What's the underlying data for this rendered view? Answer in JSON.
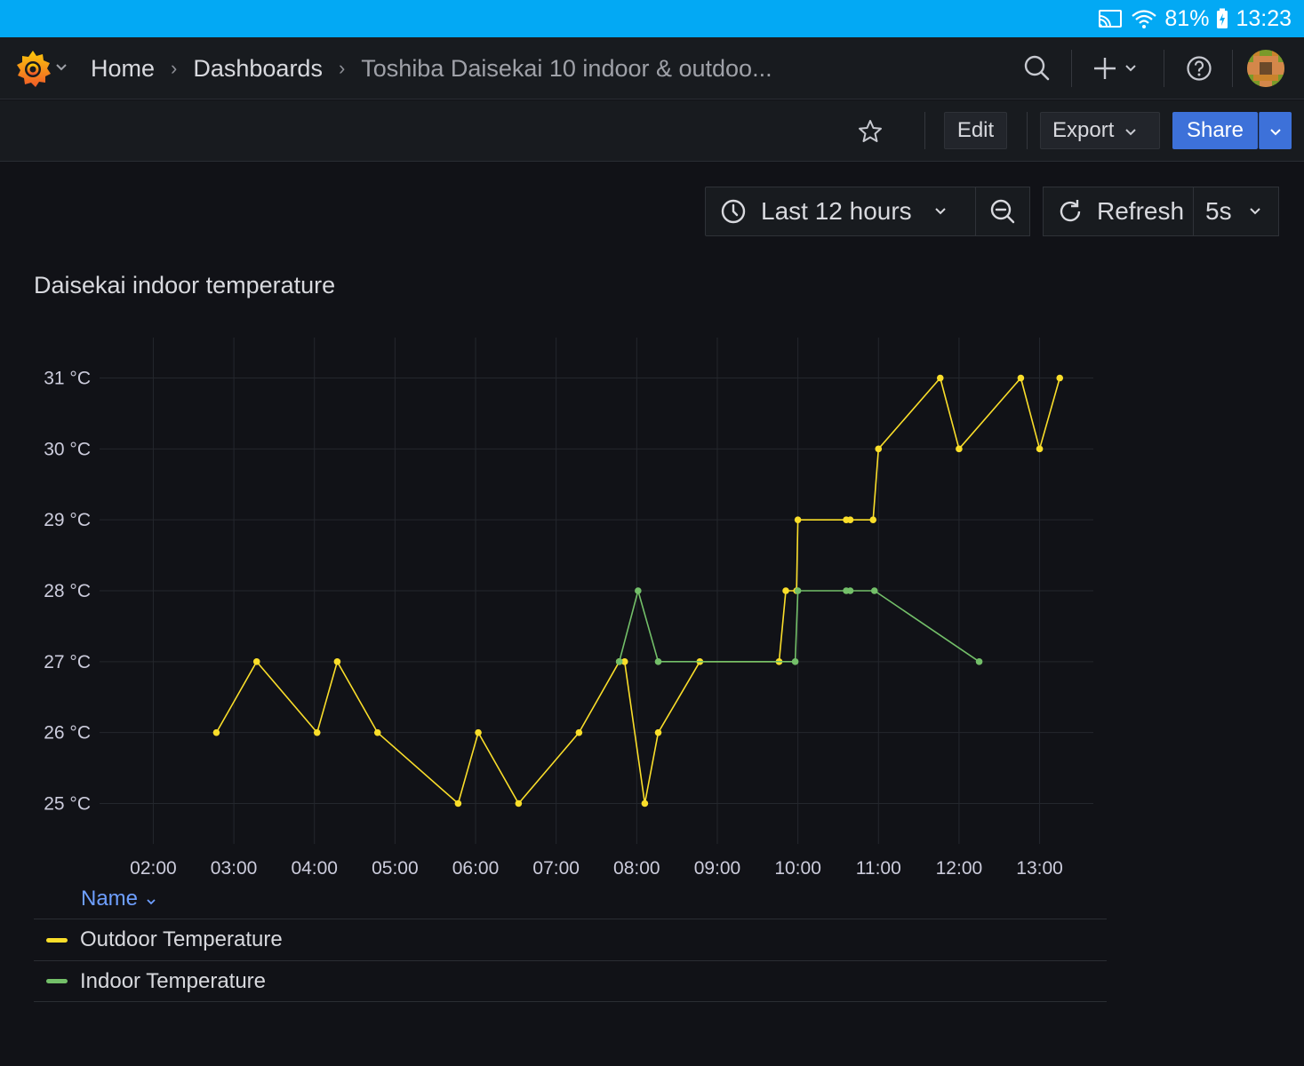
{
  "status_bar": {
    "battery": "81%",
    "time": "13:23"
  },
  "breadcrumb": [
    "Home",
    "Dashboards",
    "Toshiba Daisekai 10 indoor & outdoo..."
  ],
  "toolbar": {
    "edit": "Edit",
    "export": "Export",
    "share": "Share"
  },
  "time_range": {
    "label": "Last 12 hours",
    "refresh_label": "Refresh",
    "refresh_interval": "5s"
  },
  "panel": {
    "title": "Daisekai indoor temperature"
  },
  "legend": {
    "header": "Name",
    "items": [
      "Outdoor Temperature",
      "Indoor Temperature"
    ]
  },
  "colors": {
    "outdoor": "#fade2a",
    "indoor": "#73bf69",
    "accent": "#3d71d9",
    "status_bar": "#03a9f4"
  },
  "chart_data": {
    "type": "line",
    "x_ticks": [
      "02:00",
      "03:00",
      "04:00",
      "05:00",
      "06:00",
      "07:00",
      "08:00",
      "09:00",
      "10:00",
      "11:00",
      "12:00",
      "13:00"
    ],
    "y_ticks": [
      "25 °C",
      "26 °C",
      "27 °C",
      "28 °C",
      "29 °C",
      "30 °C",
      "31 °C"
    ],
    "xlim": [
      "01:20",
      "13:40"
    ],
    "ylim": [
      24.43,
      31.57
    ],
    "grid": true,
    "legend_position": "bottom",
    "series": [
      {
        "name": "Outdoor Temperature",
        "color": "#fade2a",
        "points": [
          [
            "02:47",
            26
          ],
          [
            "03:17",
            27
          ],
          [
            "04:02",
            26
          ],
          [
            "04:17",
            27
          ],
          [
            "04:47",
            26
          ],
          [
            "05:47",
            25
          ],
          [
            "06:02",
            26
          ],
          [
            "06:32",
            25
          ],
          [
            "07:17",
            26
          ],
          [
            "07:47",
            27
          ],
          [
            "07:51",
            27
          ],
          [
            "08:06",
            25
          ],
          [
            "08:16",
            26
          ],
          [
            "08:47",
            27
          ],
          [
            "09:46",
            27
          ],
          [
            "09:51",
            28
          ],
          [
            "09:59",
            28
          ],
          [
            "10:00",
            29
          ],
          [
            "10:36",
            29
          ],
          [
            "10:39",
            29
          ],
          [
            "10:56",
            29
          ],
          [
            "11:00",
            30
          ],
          [
            "11:46",
            31
          ],
          [
            "12:00",
            30
          ],
          [
            "12:46",
            31
          ],
          [
            "13:00",
            30
          ],
          [
            "13:15",
            31
          ]
        ]
      },
      {
        "name": "Indoor Temperature",
        "color": "#73bf69",
        "points": [
          [
            "07:47",
            27
          ],
          [
            "08:01",
            28
          ],
          [
            "08:16",
            27
          ],
          [
            "09:58",
            27
          ],
          [
            "10:00",
            28
          ],
          [
            "10:36",
            28
          ],
          [
            "10:39",
            28
          ],
          [
            "10:57",
            28
          ],
          [
            "12:15",
            27
          ]
        ]
      }
    ]
  }
}
